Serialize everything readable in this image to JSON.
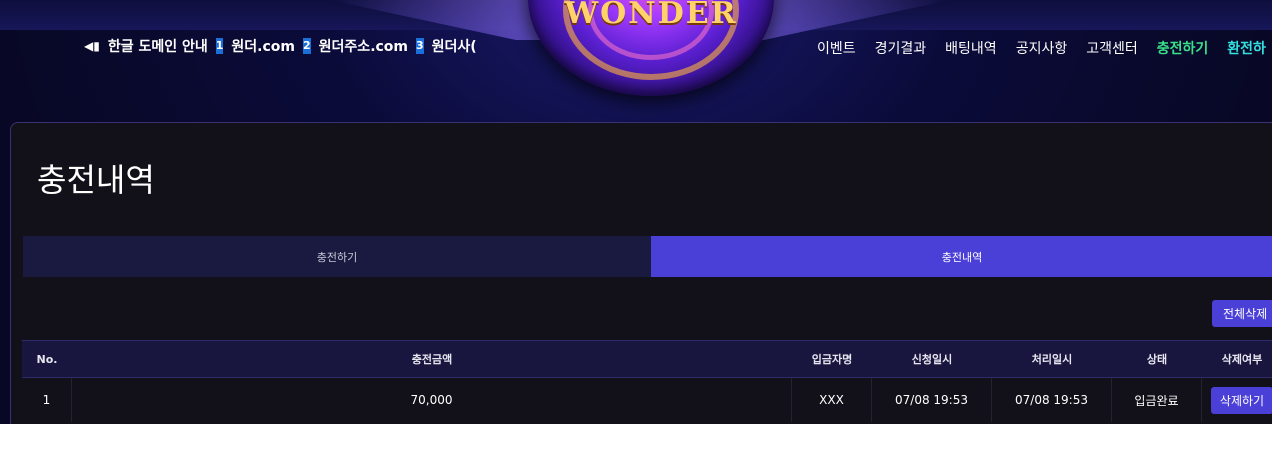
{
  "notice": {
    "megaphone_icon": "megaphone-icon",
    "lead": "한글 도메인 안내",
    "items": [
      {
        "num": "1",
        "text": "원더.com"
      },
      {
        "num": "2",
        "text": "원더주소.com"
      },
      {
        "num": "3",
        "text": "원더사("
      }
    ]
  },
  "logo": {
    "text": "WONDER"
  },
  "nav": {
    "items": [
      "이벤트",
      "경기결과",
      "배팅내역",
      "공지사항",
      "고객센터"
    ],
    "charge": "충전하기",
    "exchange": "환전하"
  },
  "page": {
    "title": "충전내역"
  },
  "tabs": [
    {
      "label": "충전하기",
      "active": false
    },
    {
      "label": "충전내역",
      "active": true
    }
  ],
  "actions": {
    "delete_all": "전체삭제"
  },
  "table": {
    "headers": [
      "No.",
      "충전금액",
      "입금자명",
      "신청일시",
      "처리일시",
      "상태",
      "삭제여부"
    ],
    "rows": [
      {
        "no": "1",
        "amount": "70,000",
        "depositor": "XXX",
        "requested": "07/08 19:53",
        "processed": "07/08 19:53",
        "status": "입금완료",
        "delete": "삭제하기"
      }
    ]
  },
  "colors": {
    "accent": "#4a3fd6",
    "green": "#39e08a",
    "cyan": "#33e0e0",
    "panel": "#121018"
  }
}
